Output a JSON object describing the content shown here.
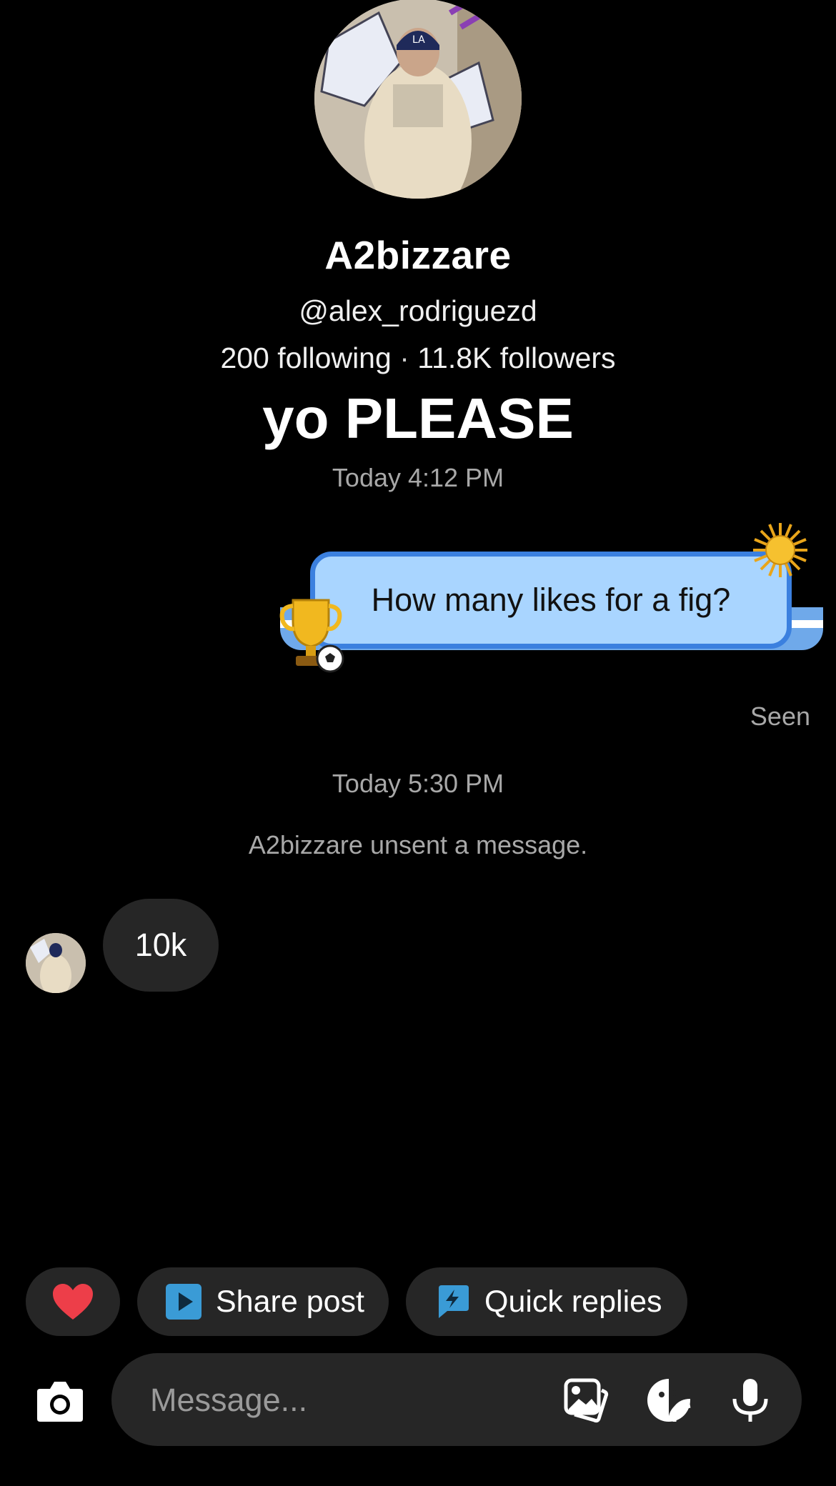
{
  "profile": {
    "name": "A2bizzare",
    "handle": "@alex_rodriguezd",
    "following": "200 following",
    "separator": "·",
    "followers": "11.8K followers",
    "note": "yo PLEASE"
  },
  "thread": {
    "timestamp_1": "Today 4:12 PM",
    "outgoing_message": "How many likes for a fig?",
    "seen_label": "Seen",
    "timestamp_2": "Today 5:30 PM",
    "unsent_notice": "A2bizzare unsent a message.",
    "incoming_message": "10k"
  },
  "quick_actions": {
    "heart_icon": "red-heart",
    "share_post_label": "Share post",
    "quick_replies_label": "Quick replies"
  },
  "composer": {
    "placeholder": "Message...",
    "icons": [
      "camera-icon",
      "gallery-icon",
      "sticker-icon",
      "microphone-icon"
    ]
  },
  "colors": {
    "background": "#000000",
    "bubble_outgoing": "#a9d5ff",
    "bubble_border": "#3b80df",
    "bubble_incoming": "#262626",
    "accent_icon": "#3a9bd6",
    "heart": "#ed3e49"
  }
}
